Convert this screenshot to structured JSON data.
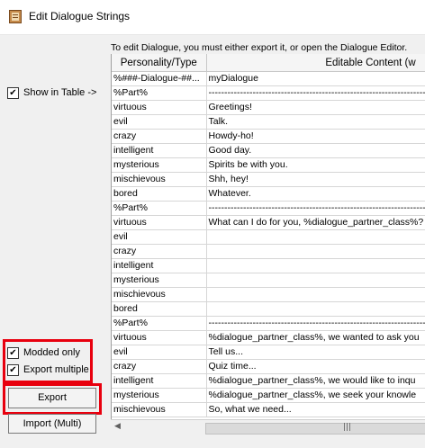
{
  "window": {
    "title": "Edit Dialogue Strings"
  },
  "left": {
    "show_in_table": {
      "label": "Show in Table ->",
      "checked": true
    },
    "modded_only": {
      "label": "Modded only",
      "checked": true
    },
    "export_multiple": {
      "label": "Export multiple",
      "checked": true
    },
    "export_button": "Export",
    "import_button": "Import (Multi)"
  },
  "instruction": "To edit Dialogue, you must either export it, or open the Dialogue Editor.",
  "table": {
    "headers": [
      "Personality/Type",
      "Editable Content (w"
    ],
    "rows": [
      [
        "%###-Dialogue-##...",
        "myDialogue"
      ],
      [
        "%Part%",
        "----------------------------------------------------------------------------"
      ],
      [
        "virtuous",
        "Greetings!"
      ],
      [
        "evil",
        "Talk."
      ],
      [
        "crazy",
        "Howdy-ho!"
      ],
      [
        "intelligent",
        "Good day."
      ],
      [
        "mysterious",
        "Spirits be with you."
      ],
      [
        "mischievous",
        "Shh, hey!"
      ],
      [
        "bored",
        "Whatever."
      ],
      [
        "%Part%",
        "----------------------------------------------------------------------------"
      ],
      [
        "virtuous",
        "What can I do for you, %dialogue_partner_class%?"
      ],
      [
        "evil",
        ""
      ],
      [
        "crazy",
        ""
      ],
      [
        "intelligent",
        ""
      ],
      [
        "mysterious",
        ""
      ],
      [
        "mischievous",
        ""
      ],
      [
        "bored",
        ""
      ],
      [
        "%Part%",
        "----------------------------------------------------------------------------"
      ],
      [
        "virtuous",
        "%dialogue_partner_class%, we wanted to ask you"
      ],
      [
        "evil",
        "Tell us..."
      ],
      [
        "crazy",
        "Quiz time..."
      ],
      [
        "intelligent",
        "%dialogue_partner_class%, we would like to inqu"
      ],
      [
        "mysterious",
        "%dialogue_partner_class%, we seek your knowle"
      ],
      [
        "mischievous",
        "So, what we need..."
      ]
    ]
  },
  "icons": {
    "app": "dialogue-book-icon",
    "scroll_left": "arrow-left-icon",
    "scroll_grip": "scroll-grip-icon"
  },
  "colors": {
    "highlight": "#e8000e"
  }
}
